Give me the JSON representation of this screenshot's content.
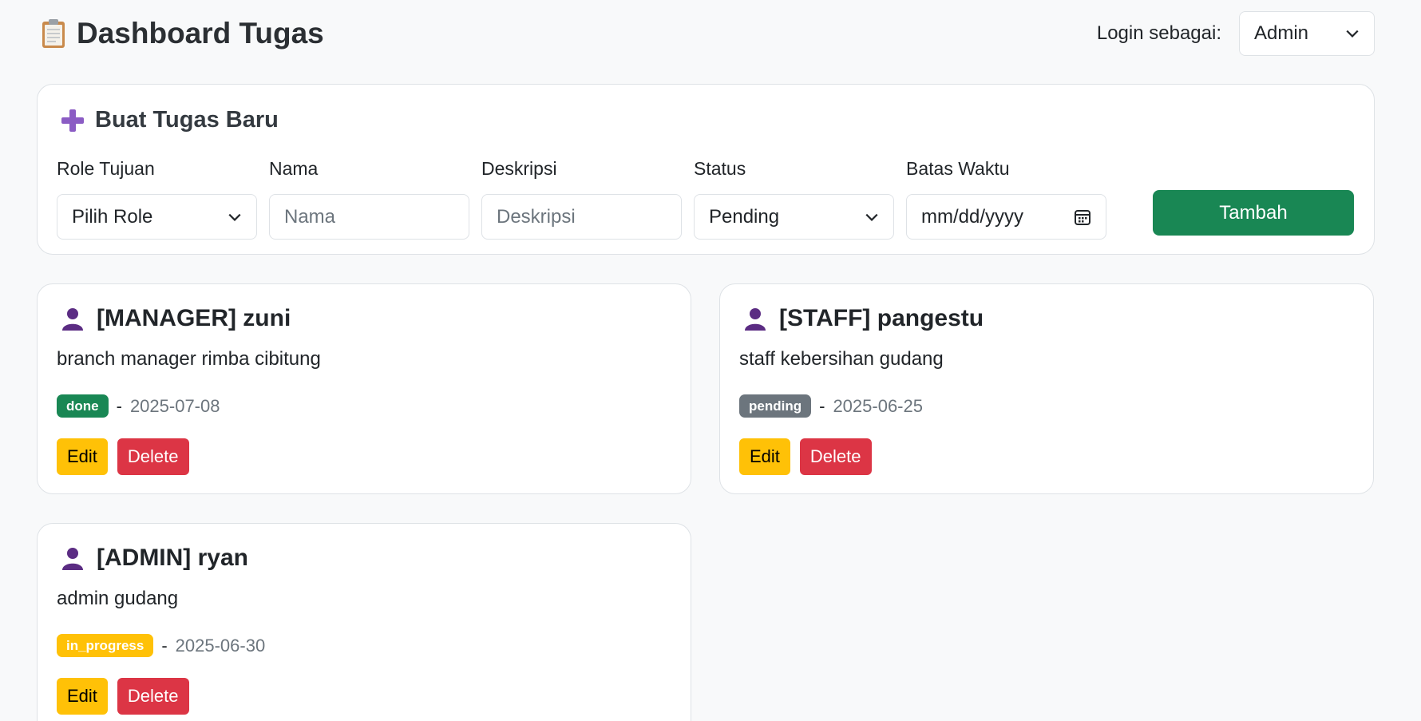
{
  "header": {
    "title": "Dashboard Tugas",
    "title_icon": "clipboard-icon",
    "login_label": "Login sebagai:",
    "login_role": "Admin"
  },
  "form": {
    "title": "Buat Tugas Baru",
    "title_icon": "plus-icon",
    "fields": {
      "role": {
        "label": "Role Tujuan",
        "value": "Pilih Role"
      },
      "nama": {
        "label": "Nama",
        "placeholder": "Nama"
      },
      "deskripsi": {
        "label": "Deskripsi",
        "placeholder": "Deskripsi"
      },
      "status": {
        "label": "Status",
        "value": "Pending"
      },
      "batas_waktu": {
        "label": "Batas Waktu",
        "placeholder": "mm/dd/yyyy"
      }
    },
    "submit_label": "Tambah"
  },
  "tasks": [
    {
      "title": "[MANAGER] zuni",
      "description": "branch manager rimba cibitung",
      "status": "done",
      "separator": "-",
      "date": "2025-07-08",
      "edit_label": "Edit",
      "delete_label": "Delete"
    },
    {
      "title": "[STAFF] pangestu",
      "description": "staff kebersihan gudang",
      "status": "pending",
      "separator": "-",
      "date": "2025-06-25",
      "edit_label": "Edit",
      "delete_label": "Delete"
    },
    {
      "title": "[ADMIN] ryan",
      "description": "admin gudang",
      "status": "in_progress",
      "separator": "-",
      "date": "2025-06-30",
      "edit_label": "Edit",
      "delete_label": "Delete"
    }
  ],
  "colors": {
    "success": "#198754",
    "secondary": "#6c757d",
    "warning": "#ffc107",
    "danger": "#dc3545",
    "person_icon": "#5b2c83"
  }
}
